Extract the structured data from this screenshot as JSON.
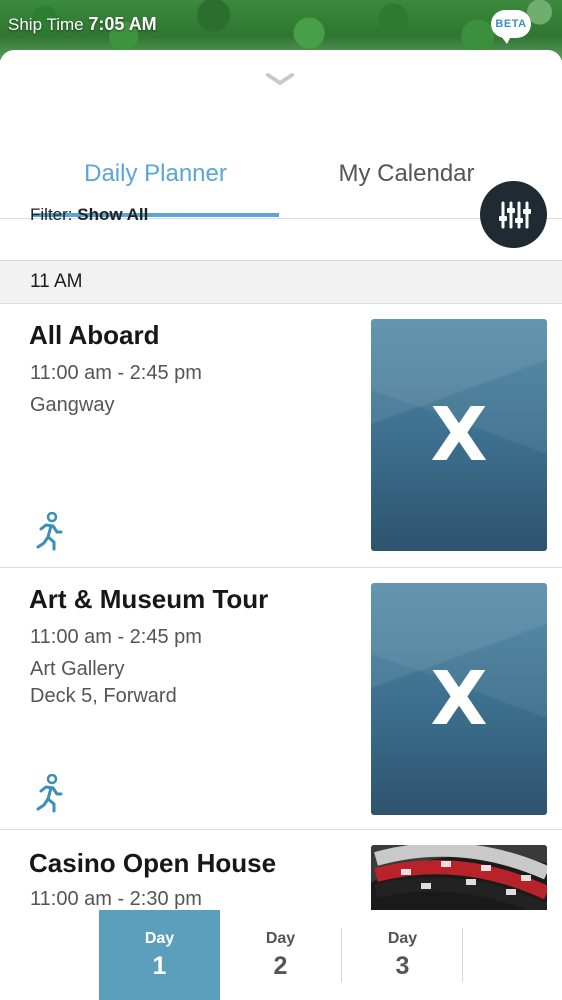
{
  "status": {
    "ship_time_label": "Ship Time",
    "ship_time_value": "7:05 AM",
    "beta_badge": "BETA"
  },
  "tabs": [
    {
      "label": "Daily Planner",
      "active": true
    },
    {
      "label": "My Calendar",
      "active": false
    }
  ],
  "filter": {
    "label": "Filter:",
    "value": "Show All",
    "icon": "sliders-icon"
  },
  "section": {
    "time_header": "11 AM"
  },
  "events": [
    {
      "title": "All Aboard",
      "time": "11:00 am - 2:45 pm",
      "location_line1": "Gangway",
      "location_line2": "",
      "icon": "walking-person-icon",
      "thumbnail": "x-logo"
    },
    {
      "title": "Art & Museum Tour",
      "time": "11:00 am - 2:45 pm",
      "location_line1": "Art Gallery",
      "location_line2": "Deck 5, Forward",
      "icon": "walking-person-icon",
      "thumbnail": "x-logo"
    },
    {
      "title": "Casino Open House",
      "time": "11:00 am - 2:30 pm",
      "thumbnail": "roulette-photo"
    }
  ],
  "days": [
    {
      "label": "Day",
      "number": "1",
      "active": true
    },
    {
      "label": "Day",
      "number": "2",
      "active": false
    },
    {
      "label": "Day",
      "number": "3",
      "active": false
    }
  ],
  "colors": {
    "accent": "#5aa6d6",
    "day_active": "#5b9fbd",
    "filter_button": "#1f2a33",
    "walk_icon": "#3a8fb7"
  },
  "thumb_text": "X"
}
